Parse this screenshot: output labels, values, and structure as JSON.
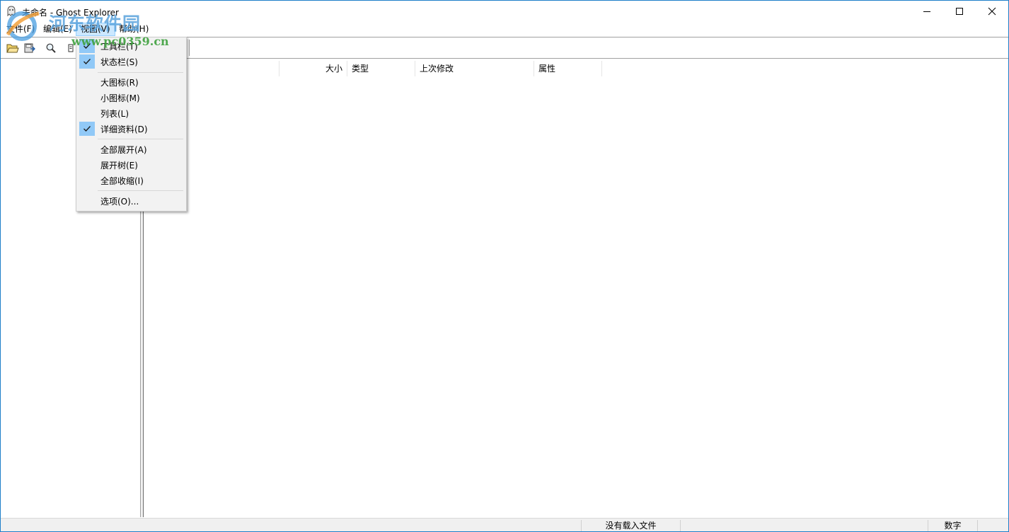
{
  "window": {
    "title": "未命名 - Ghost Explorer"
  },
  "watermark": {
    "site_name": "河东软件园",
    "url": "www.pc0359.cn"
  },
  "menubar": {
    "items": [
      {
        "label": "文件(F)"
      },
      {
        "label": "编辑(E)"
      },
      {
        "label": "视图(V)"
      },
      {
        "label": "帮助(H)"
      }
    ]
  },
  "toolbar": {
    "buttons": [
      {
        "icon": "open-folder-icon"
      },
      {
        "icon": "save-icon"
      },
      {
        "icon": "search-icon"
      },
      {
        "icon": "properties-icon"
      }
    ]
  },
  "view_menu": {
    "items": [
      {
        "label": "工具栏(T)",
        "checked": true
      },
      {
        "label": "状态栏(S)",
        "checked": true
      },
      {
        "label": "大图标(R)",
        "checked": false
      },
      {
        "label": "小图标(M)",
        "checked": false
      },
      {
        "label": "列表(L)",
        "checked": false
      },
      {
        "label": "详细资料(D)",
        "checked": true
      },
      {
        "label": "全部展开(A)",
        "checked": false
      },
      {
        "label": "展开树(E)",
        "checked": false
      },
      {
        "label": "全部收缩(I)",
        "checked": false
      },
      {
        "label": "选项(O)...",
        "checked": false
      }
    ]
  },
  "list": {
    "columns": [
      {
        "label": "大小"
      },
      {
        "label": "类型"
      },
      {
        "label": "上次修改"
      },
      {
        "label": "属性"
      }
    ]
  },
  "statusbar": {
    "message": "没有载入文件",
    "mode": "数字"
  },
  "colors": {
    "accent": "#1e7fc9",
    "menu_highlight": "#cce8ff",
    "check_bg": "#91c9f7"
  }
}
